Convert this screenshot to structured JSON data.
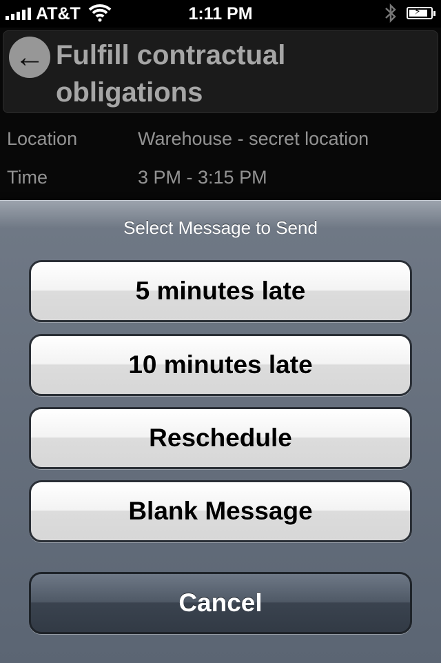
{
  "status_bar": {
    "carrier": "AT&T",
    "time": "1:11 PM",
    "battery_level": 0.85
  },
  "event": {
    "title": "Fulfill contractual obligations",
    "details": [
      {
        "label": "Location",
        "value": "Warehouse - secret location"
      },
      {
        "label": "Time",
        "value": "3 PM - 3:15 PM"
      }
    ]
  },
  "action_sheet": {
    "title": "Select Message to Send",
    "options": [
      {
        "label": "5 minutes late"
      },
      {
        "label": "10 minutes late"
      },
      {
        "label": "Reschedule"
      },
      {
        "label": "Blank Message"
      }
    ],
    "cancel_label": "Cancel"
  },
  "icons": [
    "signal-icon",
    "wifi-icon",
    "bluetooth-icon",
    "battery-icon",
    "back-arrow-icon"
  ]
}
